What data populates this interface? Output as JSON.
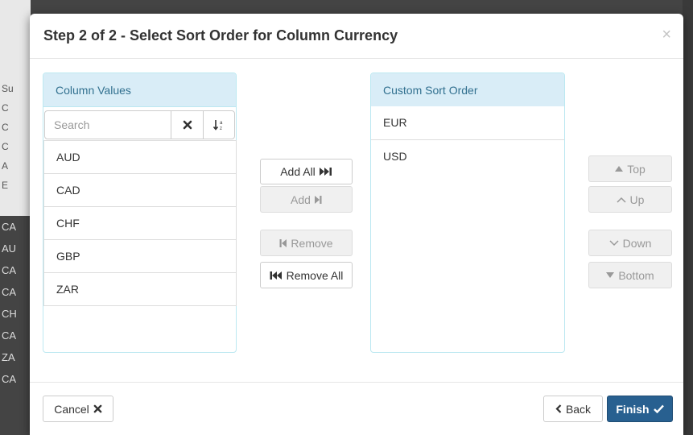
{
  "background": {
    "side_rows_white": [
      "Su",
      "C",
      "C",
      "C",
      "A",
      "E"
    ],
    "side_rows_dark": [
      "CA",
      "AU",
      "CA",
      "CA",
      "CH",
      "CA",
      "ZA",
      "CA"
    ]
  },
  "modal": {
    "title": "Step 2 of 2 - Select Sort Order for Column Currency",
    "close_symbol": "×"
  },
  "left_panel": {
    "heading": "Column Values",
    "search_placeholder": "Search",
    "items": [
      "AUD",
      "CAD",
      "CHF",
      "GBP",
      "ZAR"
    ]
  },
  "transfer": {
    "add_all": "Add All",
    "add": "Add",
    "remove": "Remove",
    "remove_all": "Remove All"
  },
  "right_panel": {
    "heading": "Custom Sort Order",
    "items": [
      "EUR",
      "USD"
    ]
  },
  "reorder": {
    "top": "Top",
    "up": "Up",
    "down": "Down",
    "bottom": "Bottom"
  },
  "footer": {
    "cancel": "Cancel",
    "back": "Back",
    "finish": "Finish"
  },
  "colors": {
    "panel_heading_bg": "#d9edf7",
    "panel_heading_text": "#31708f",
    "panel_border": "#bce8f1",
    "primary": "#286090"
  }
}
